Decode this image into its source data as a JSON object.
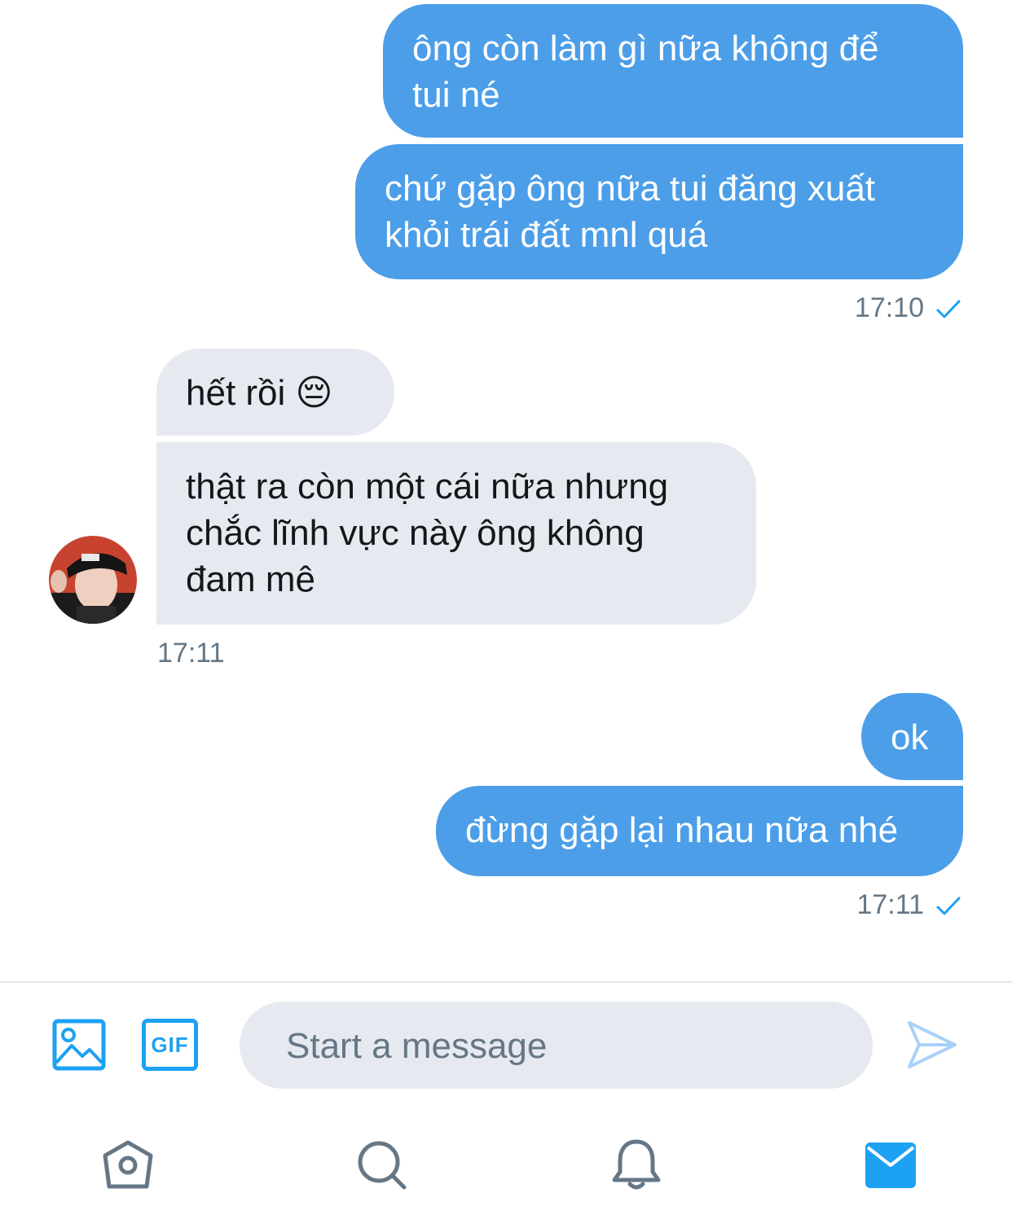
{
  "conversation": {
    "messages": [
      {
        "direction": "sent",
        "text": "ông còn làm gì nữa không để\ntui né"
      },
      {
        "direction": "sent",
        "text": "chứ gặp ông nữa tui đăng xuất\nkhỏi trái đất mnl quá"
      },
      {
        "direction": "received",
        "text": "hết rồi 😔"
      },
      {
        "direction": "received",
        "text": "thật ra còn một cái nữa nhưng\nchắc lĩnh vực này ông không\nđam mê"
      },
      {
        "direction": "sent",
        "text": "ok"
      },
      {
        "direction": "sent",
        "text": "đừng gặp lại nhau nữa nhé"
      }
    ],
    "timestamps": {
      "group1": "17:10",
      "group2": "17:11",
      "group3": "17:11"
    }
  },
  "composer": {
    "placeholder": "Start a message",
    "value": "",
    "media_icon": "image-icon",
    "gif_label": "GIF",
    "send_icon": "send-icon"
  },
  "nav": {
    "items": [
      {
        "icon": "home-icon",
        "active": false
      },
      {
        "icon": "search-icon",
        "active": false
      },
      {
        "icon": "bell-icon",
        "active": false
      },
      {
        "icon": "mail-icon",
        "active": true
      }
    ]
  },
  "colors": {
    "accent": "#1da1f2",
    "sent_bubble": "#4c9ee8",
    "received_bubble": "#e6e9ef",
    "secondary_text": "#657786",
    "inactive_icon": "#657786"
  }
}
